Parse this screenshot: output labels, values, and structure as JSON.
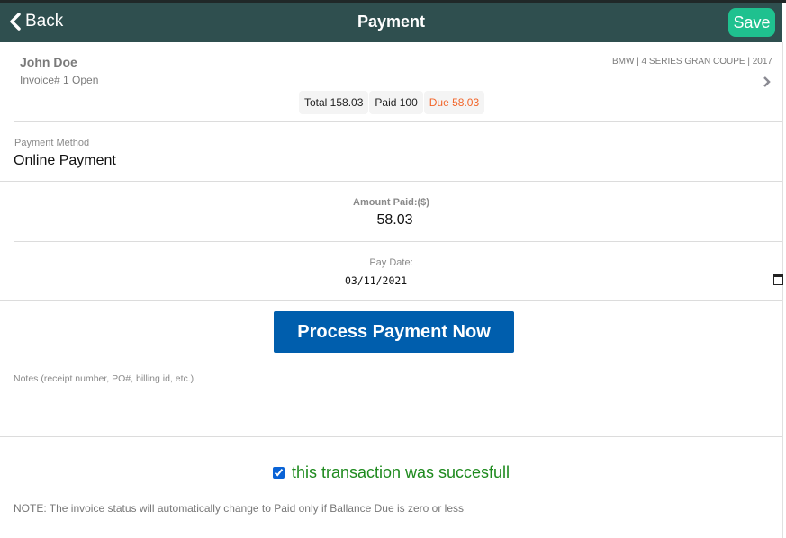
{
  "header": {
    "back_label": "Back",
    "title": "Payment",
    "save_label": "Save",
    "colors": {
      "bar": "#2f4f4f",
      "save": "#1fc18f"
    }
  },
  "invoice": {
    "customer_name": "John Doe",
    "invoice_line": "Invoice# 1 Open",
    "vehicle": "BMW | 4 SERIES GRAN COUPE | 2017",
    "totals": {
      "total": "Total 158.03",
      "paid": "Paid 100",
      "due": "Due 58.03"
    }
  },
  "payment_method": {
    "label": "Payment Method",
    "value": "Online Payment"
  },
  "amount_paid": {
    "label": "Amount Paid:($)",
    "value": "58.03"
  },
  "pay_date": {
    "label": "Pay Date:",
    "value": "03/11/2021"
  },
  "process_button": {
    "label": "Process Payment Now",
    "color": "#005ead"
  },
  "notes": {
    "placeholder": "Notes (receipt number, PO#, billing id, etc.)",
    "value": ""
  },
  "success": {
    "checked": true,
    "label": "this transaction was succesfull"
  },
  "footer_note": "NOTE: The invoice status will automatically change to Paid only if Ballance Due is zero or less"
}
